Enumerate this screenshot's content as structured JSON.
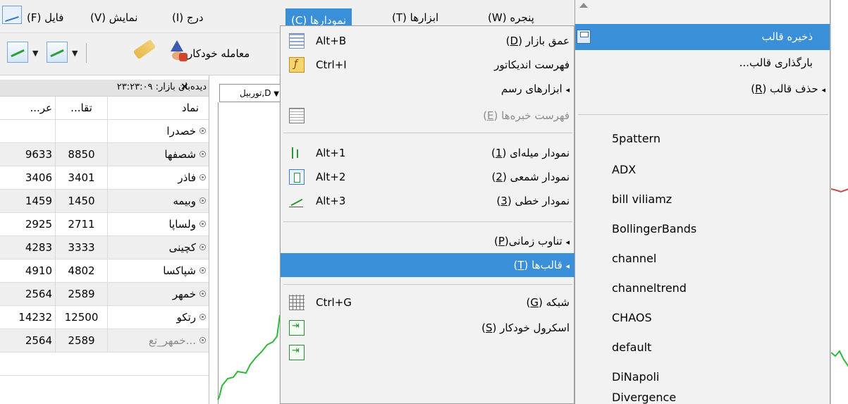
{
  "menubar": {
    "items": [
      "فایل (F)",
      "نمایش (V)",
      "درج (I)",
      "نمودارها (C)",
      "ابزارها (T)",
      "پنجره (W)"
    ],
    "active_index": 3
  },
  "toolbar": {
    "auto_trading_label": "معامله خودکار"
  },
  "market_watch": {
    "title": "دیده‌بان بازار: ۲۳:۲۳:۰۹",
    "headers": {
      "symbol": "نماد",
      "bid": "...تقا",
      "ask": "...عر"
    },
    "rows": [
      {
        "symbol": "خصدرا",
        "bid": "",
        "ask": ""
      },
      {
        "symbol": "شصفها",
        "bid": "8850",
        "ask": "9633"
      },
      {
        "symbol": "فاذر",
        "bid": "3401",
        "ask": "3406"
      },
      {
        "symbol": "وبیمه",
        "bid": "1450",
        "ask": "1459"
      },
      {
        "symbol": "ولساپا",
        "bid": "2711",
        "ask": "2925"
      },
      {
        "symbol": "کچینی",
        "bid": "3333",
        "ask": "4283"
      },
      {
        "symbol": "شپاکسا",
        "bid": "4802",
        "ask": "4910"
      },
      {
        "symbol": "خمهر",
        "bid": "2589",
        "ask": "2564"
      },
      {
        "symbol": "رتکو",
        "bid": "12500",
        "ask": "14232"
      },
      {
        "symbol": "...خمهر_تع",
        "bid": "2589",
        "ask": "2564"
      }
    ]
  },
  "chart": {
    "tab_label": "D,توربیل"
  },
  "charts_menu": {
    "depth": {
      "label": "عمق بازار",
      "key": "D",
      "shortcut": "Alt+B"
    },
    "indicators": {
      "label": "فهرست اندیکاتور",
      "shortcut": "Ctrl+I"
    },
    "drawing_tools": {
      "label": "ابزارهای رسم"
    },
    "experts": {
      "label": "فهرست خبره‌ها",
      "key": "E"
    },
    "bar_chart": {
      "label": "نمودار میله‌ای",
      "key": "1",
      "shortcut": "Alt+1"
    },
    "candle_chart": {
      "label": "نمودار شمعی",
      "key": "2",
      "shortcut": "Alt+2"
    },
    "line_chart": {
      "label": "نمودار خطی",
      "key": "3",
      "shortcut": "Alt+3"
    },
    "periodicity": {
      "label": "تناوب زمانی",
      "key": "P"
    },
    "templates": {
      "label": "قالب‌ها",
      "key": "T"
    },
    "grid": {
      "label": "شبکه",
      "key": "G",
      "shortcut": "Ctrl+G"
    },
    "autoscroll": {
      "label": "اسکرول خودکار",
      "key": "S"
    }
  },
  "templates_menu": {
    "save": "ذخیره قالب",
    "load": "بارگذاری قالب...",
    "remove": {
      "label": "حذف قالب",
      "key": "R"
    },
    "items": [
      "5pattern",
      "ADX",
      "bill viliamz",
      "BollingerBands",
      "channel",
      "channeltrend",
      "CHAOS",
      "default",
      "DiNapoli",
      "Divergence"
    ]
  }
}
